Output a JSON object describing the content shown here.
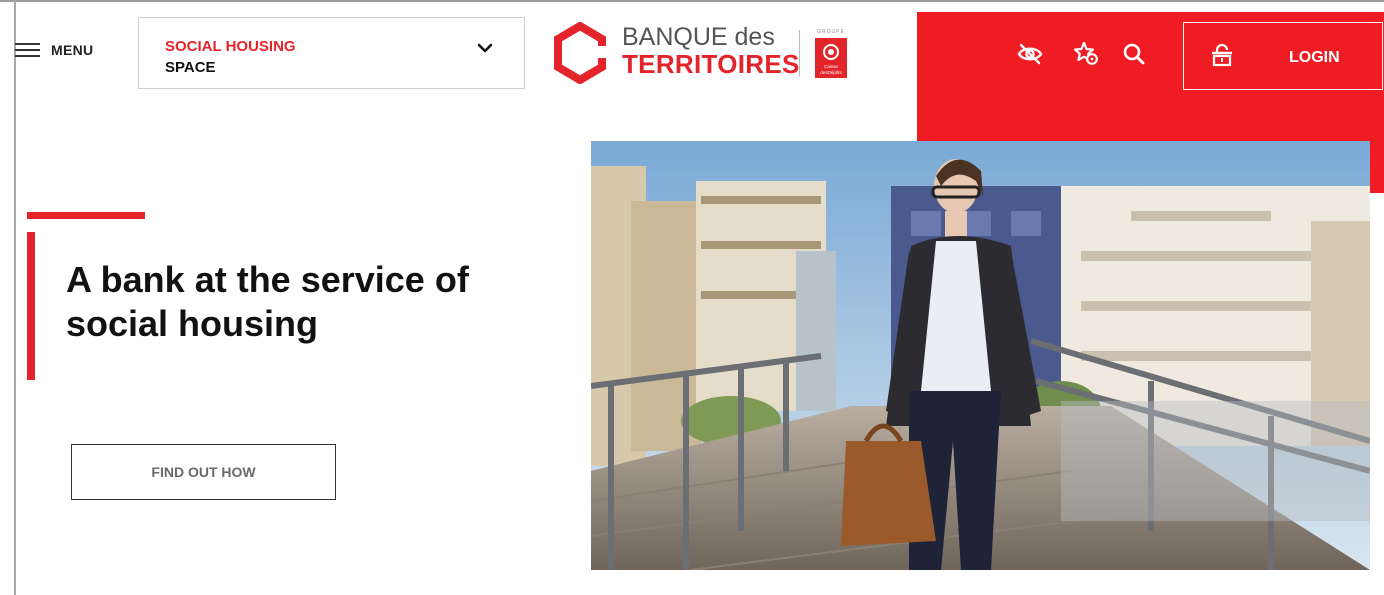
{
  "header": {
    "menu_label": "MENU",
    "space_selector": {
      "title": "SOCIAL HOUSING",
      "subtitle": "SPACE"
    },
    "logo": {
      "line1": "BANQUE des",
      "line2": "TERRITOIRES",
      "group_text": "GROUPE Caisse des Dépôts"
    },
    "tools": [
      "eye-icon",
      "star-pin-icon",
      "search-icon"
    ],
    "login_label": "LOGIN",
    "accent_color": "#ef1d23"
  },
  "hero": {
    "title": "A bank at the service of social housing",
    "cta_label": "FIND OUT HOW",
    "image_alt": "Woman walking on a wooden footbridge with modern buildings"
  }
}
